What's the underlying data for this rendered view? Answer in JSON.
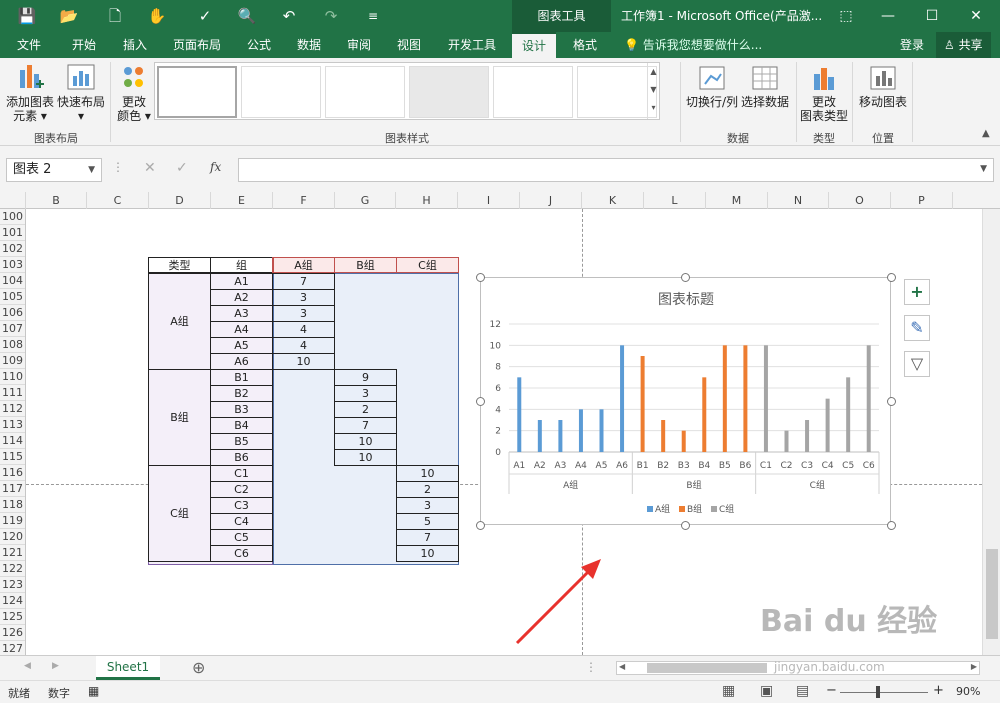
{
  "window": {
    "context_tools": "图表工具",
    "title": "工作簿1 - Microsoft Office(产品激...",
    "quick_access": {
      "save": "💾",
      "open": "📂",
      "new": "🗋",
      "touch": "✋",
      "spell": "✓",
      "preview": "🔍",
      "undo": "↶",
      "redo": "↷",
      "more": "≡"
    },
    "ribbon_display": "⬚",
    "minimize": "—",
    "maximize": "☐",
    "close": "✕"
  },
  "tabs": [
    "文件",
    "开始",
    "插入",
    "页面布局",
    "公式",
    "数据",
    "审阅",
    "视图",
    "开发工具",
    "设计",
    "格式"
  ],
  "active_tab": "设计",
  "tell_me": "告诉我您想要做什么...",
  "login": "登录",
  "share": "共享",
  "ribbon": {
    "add_element": [
      "添加图表",
      "元素"
    ],
    "quick_layout": "快速布局",
    "change_color": [
      "更改",
      "颜色"
    ],
    "group_layout": "图表布局",
    "group_styles": "图表样式",
    "switch_rowcol": "切换行/列",
    "select_data": "选择数据",
    "group_data": "数据",
    "change_type": [
      "更改",
      "图表类型"
    ],
    "group_type": "类型",
    "move_chart": "移动图表",
    "group_location": "位置"
  },
  "namebox": "图表 2",
  "fx_label": "fx",
  "columns": [
    "B",
    "C",
    "D",
    "E",
    "F",
    "G",
    "H",
    "I",
    "J",
    "K",
    "L",
    "M",
    "N",
    "O",
    "P"
  ],
  "rows": [
    "100",
    "101",
    "102",
    "103",
    "104",
    "105",
    "106",
    "107",
    "108",
    "109",
    "110",
    "111",
    "112",
    "113",
    "114",
    "115",
    "116",
    "117",
    "118",
    "119",
    "120",
    "121",
    "122",
    "123",
    "124",
    "125",
    "126",
    "127"
  ],
  "table": {
    "headers": [
      "类型",
      "组",
      "A组",
      "B组",
      "C组"
    ],
    "groups": [
      {
        "type": "A组",
        "items": [
          {
            "name": "A1",
            "val": "7"
          },
          {
            "name": "A2",
            "val": "3"
          },
          {
            "name": "A3",
            "val": "3"
          },
          {
            "name": "A4",
            "val": "4"
          },
          {
            "name": "A5",
            "val": "4"
          },
          {
            "name": "A6",
            "val": "10"
          }
        ]
      },
      {
        "type": "B组",
        "items": [
          {
            "name": "B1",
            "val": "9"
          },
          {
            "name": "B2",
            "val": "3"
          },
          {
            "name": "B3",
            "val": "2"
          },
          {
            "name": "B4",
            "val": "7"
          },
          {
            "name": "B5",
            "val": "10"
          },
          {
            "name": "B6",
            "val": "10"
          }
        ]
      },
      {
        "type": "C组",
        "items": [
          {
            "name": "C1",
            "val": "10"
          },
          {
            "name": "C2",
            "val": "2"
          },
          {
            "name": "C3",
            "val": "3"
          },
          {
            "name": "C4",
            "val": "5"
          },
          {
            "name": "C5",
            "val": "7"
          },
          {
            "name": "C6",
            "val": "10"
          }
        ]
      }
    ]
  },
  "chart_data": {
    "type": "bar",
    "title": "图表标题",
    "categories": [
      "A1",
      "A2",
      "A3",
      "A4",
      "A5",
      "A6",
      "B1",
      "B2",
      "B3",
      "B4",
      "B5",
      "B6",
      "C1",
      "C2",
      "C3",
      "C4",
      "C5",
      "C6"
    ],
    "category_groups": [
      "A组",
      "B组",
      "C组"
    ],
    "series": [
      {
        "name": "A组",
        "color": "#5b9bd5",
        "values": [
          7,
          3,
          3,
          4,
          4,
          10,
          null,
          null,
          null,
          null,
          null,
          null,
          null,
          null,
          null,
          null,
          null,
          null
        ]
      },
      {
        "name": "B组",
        "color": "#ed7d31",
        "values": [
          null,
          null,
          null,
          null,
          null,
          null,
          9,
          3,
          2,
          7,
          10,
          10,
          null,
          null,
          null,
          null,
          null,
          null
        ]
      },
      {
        "name": "C组",
        "color": "#a5a5a5",
        "values": [
          null,
          null,
          null,
          null,
          null,
          null,
          null,
          null,
          null,
          null,
          null,
          null,
          10,
          2,
          3,
          5,
          7,
          10
        ]
      }
    ],
    "yticks": [
      "0",
      "2",
      "4",
      "6",
      "8",
      "10",
      "12"
    ],
    "ylim": [
      0,
      12
    ],
    "grid": true,
    "legend": "bottom"
  },
  "chart_tools": {
    "add": "+",
    "style": "✎",
    "filter": "▽"
  },
  "sheet_tab": "Sheet1",
  "add_sheet": "⊕",
  "status": {
    "ready": "就绪",
    "numlock": "数字",
    "zoom": "90%"
  },
  "watermark": {
    "main": "Bai du 经验",
    "sub": "jingyan.baidu.com"
  }
}
